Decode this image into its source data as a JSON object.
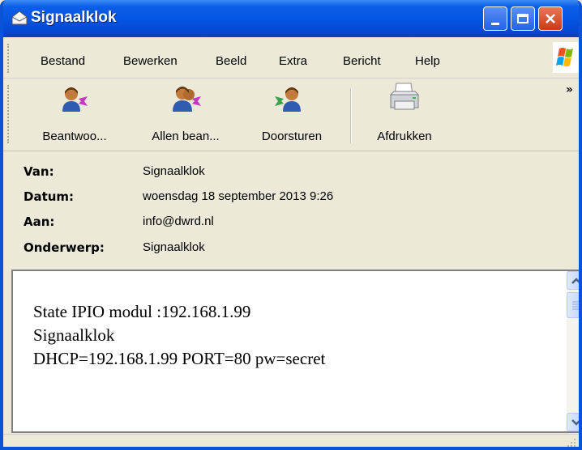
{
  "window": {
    "title": "Signaalklok",
    "controls": [
      "minimize",
      "maximize",
      "close"
    ]
  },
  "menubar": {
    "items": [
      {
        "label": "Bestand"
      },
      {
        "label": "Bewerken"
      },
      {
        "label": "Beeld"
      },
      {
        "label": "Extra"
      },
      {
        "label": "Bericht"
      },
      {
        "label": "Help"
      }
    ]
  },
  "toolbar": {
    "buttons": [
      {
        "label": "Beantwoo...",
        "icon": "reply-icon"
      },
      {
        "label": "Allen bean...",
        "icon": "reply-all-icon"
      },
      {
        "label": "Doorsturen",
        "icon": "forward-icon"
      },
      {
        "label": "Afdrukken",
        "icon": "printer-icon"
      }
    ],
    "overflow": "»"
  },
  "headers": {
    "from": {
      "label": "Van:",
      "value": "Signaalklok"
    },
    "date": {
      "label": "Datum:",
      "value": "woensdag 18 september 2013 9:26"
    },
    "to": {
      "label": "Aan:",
      "value": "info@dwrd.nl"
    },
    "subject": {
      "label": "Onderwerp:",
      "value": "Signaalklok"
    }
  },
  "message": {
    "lines": [
      "State IPIO modul :192.168.1.99",
      "Signaalklok",
      "DHCP=192.168.1.99 PORT=80 pw=secret"
    ]
  },
  "colors": {
    "titlebar": "#0655e3",
    "window_bg": "#ece9d8",
    "close_button": "#c8391a"
  }
}
